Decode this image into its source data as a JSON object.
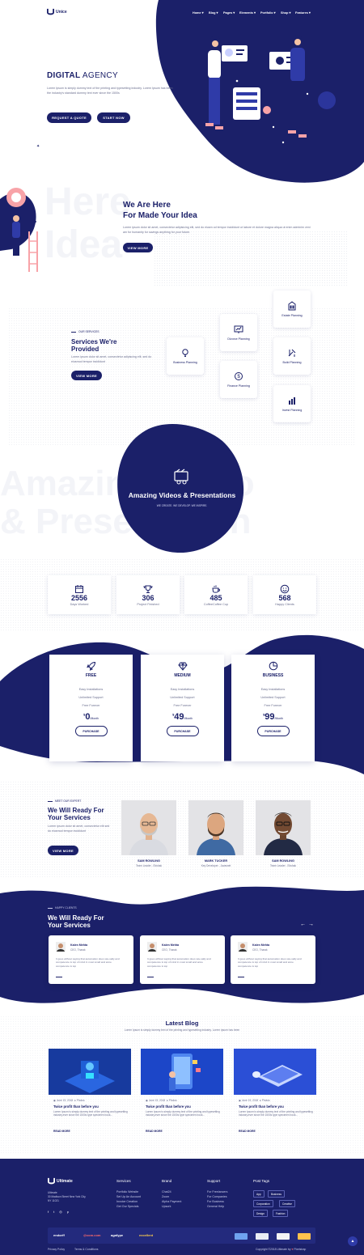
{
  "brand": {
    "name": "Unice"
  },
  "nav": [
    "Home",
    "Blog",
    "Pages",
    "Elements",
    "Portfolio",
    "Shop",
    "Features"
  ],
  "hero": {
    "title_bold": "DIGITAL",
    "title_light": "AGENCY",
    "text": "Lorem Ipsum is simply dummy text of the printing and typesetting industry. Lorem Ipsum has been the industry's standard dummy text ever since the 1500s",
    "btn_quote": "REQUEST A QUOTE",
    "btn_start": "START NOW"
  },
  "about": {
    "watermark1": "Here",
    "watermark2": "Idea",
    "title_line1": "We Are Here",
    "title_line2": "For Made Your Idea",
    "text": "Lorem ipsum dolor sit amet, consectetur adipisicing elit, sed do eiusm od tempor incididunt ut labore et dolore magna aliqua ut enim adminim veni am for humanity for savings anything for your future.",
    "btn": "VIEW MORE"
  },
  "services": {
    "kicker": "OUR SERVICES",
    "title_line1": "Services We're",
    "title_line2": "Provided",
    "text": "Lorem ipsum dolor sit amet, consectetur adipiscing elit, sed do eiusmod tempor incididunt",
    "btn": "VIEW MORE",
    "items": [
      "Estate Planning",
      "Divorce Planning",
      "Build Planning",
      "Business Planning",
      "Finance Planning",
      "Invest Planning"
    ]
  },
  "video": {
    "watermark1": "Amazing Video",
    "watermark2": "& Presentation",
    "title": "Amazing Videos & Presentations",
    "subtitle": "WE CREATE. WE DEVELOP. WE INSPIRE."
  },
  "counters": [
    {
      "num": "2556",
      "label": "Days Worked"
    },
    {
      "num": "306",
      "label": "Project Finished"
    },
    {
      "num": "485",
      "label": "CoffeeCoffee Cup"
    },
    {
      "num": "568",
      "label": "Happy Clients"
    }
  ],
  "pricing": {
    "features": [
      "Easy Installations",
      "Unlimited Support",
      "Free Forever"
    ],
    "button": "PURCHASE",
    "currency": "$",
    "period": "/Month",
    "plans": [
      {
        "name": "FREE",
        "price": "0"
      },
      {
        "name": "MEDIUM",
        "price": "49"
      },
      {
        "name": "BUSINESS",
        "price": "99"
      }
    ]
  },
  "team": {
    "kicker": "MEET OUR EXPERT",
    "title_line1": "We Will Ready For",
    "title_line2": "Your Services",
    "text": "Lorem ipsum dolor sit amet, consectetur elit sed do eiusmod tempor incididunt",
    "btn": "VIEW MORE",
    "members": [
      {
        "name": "SAM ROWLING",
        "role": "Team Leader - Ekshak"
      },
      {
        "name": "MARK TUCKER",
        "role": "Key Developer - Javasnet"
      },
      {
        "name": "SAM ROWLING",
        "role": "Team Leader - Ekshak"
      }
    ]
  },
  "testimonials": {
    "kicker": "HAPPY CLIENTS",
    "title_line1": "We Will Ready For",
    "title_line2": "Your Services",
    "items": [
      {
        "name": "Kalen Mehta",
        "role": "CEO, Tharak",
        "text": "It goes without saying that automation does sav-ually and competence is top of mind in most small and anne competence is top"
      },
      {
        "name": "Kalen Mehta",
        "role": "CEO, Tharak",
        "text": "It goes without saying that automation does sav-ually and competence is top of mind in most small and anne competence is top"
      },
      {
        "name": "Kalen Mehta",
        "role": "CEO, Tharak",
        "text": "It goes without saying that automation does sav-ually and competence is top of mind in most small and anne competence is top"
      }
    ]
  },
  "blog": {
    "title": "Latest Blog",
    "subtitle": "Lorem Ipsum is simply dummy text of the printing and typesetting industry. Lorem ipsum has been",
    "posts": [
      {
        "date": "June 19, 2018",
        "cat": "Photos",
        "title": "Twice profit than before you",
        "text": "Lorem Ipsum is simply dummy text of the printing and typesetting industry.ever since the 1500s type specimen book...",
        "read": "READ MORE"
      },
      {
        "date": "June 19, 2018",
        "cat": "Photos",
        "title": "Twice profit than before you",
        "text": "Lorem Ipsum is simply dummy text of the printing and typesetting industry.ever since the 1500s type specimen book...",
        "read": "READ MORE"
      },
      {
        "date": "June 19, 2018",
        "cat": "Photos",
        "title": "Twice profit than before you",
        "text": "Lorem Ipsum is simply dummy text of the printing and typesetting industry.ever since the 1500s type specimen book...",
        "read": "READ MORE"
      }
    ]
  },
  "footer": {
    "brand": "Ultimate",
    "about": [
      "Ultimate",
      "30 Madison Street New York City,",
      "NY 11021"
    ],
    "cols": [
      {
        "title": "Services",
        "links": [
          "Portfolio Website",
          "Set Up An Account",
          "Invoice Creation",
          "Get Our Specials"
        ]
      },
      {
        "title": "Brand",
        "links": [
          "Chat24",
          "Zoom",
          "Alpha Payment",
          "Upsork"
        ]
      },
      {
        "title": "Support",
        "links": [
          "For Freelancers",
          "For Companies",
          "For Business",
          "General Help"
        ]
      }
    ],
    "tags_title": "Post Tags",
    "tags": [
      "App",
      "Business",
      "Corporation",
      "Creative",
      "Design",
      "Fashion"
    ],
    "partners": [
      "endorff",
      "@com.com",
      "agafype",
      "excellent"
    ],
    "bottom_links": [
      "Privacy Policy",
      "Terms & Conditions"
    ],
    "copyright": "Copyright ©2018 Ultimate by",
    "copyright_by": "Pixelstrap"
  },
  "colors": {
    "primary": "#1b2069",
    "accent": "#2f3ba8",
    "light": "#f3f4f8"
  }
}
